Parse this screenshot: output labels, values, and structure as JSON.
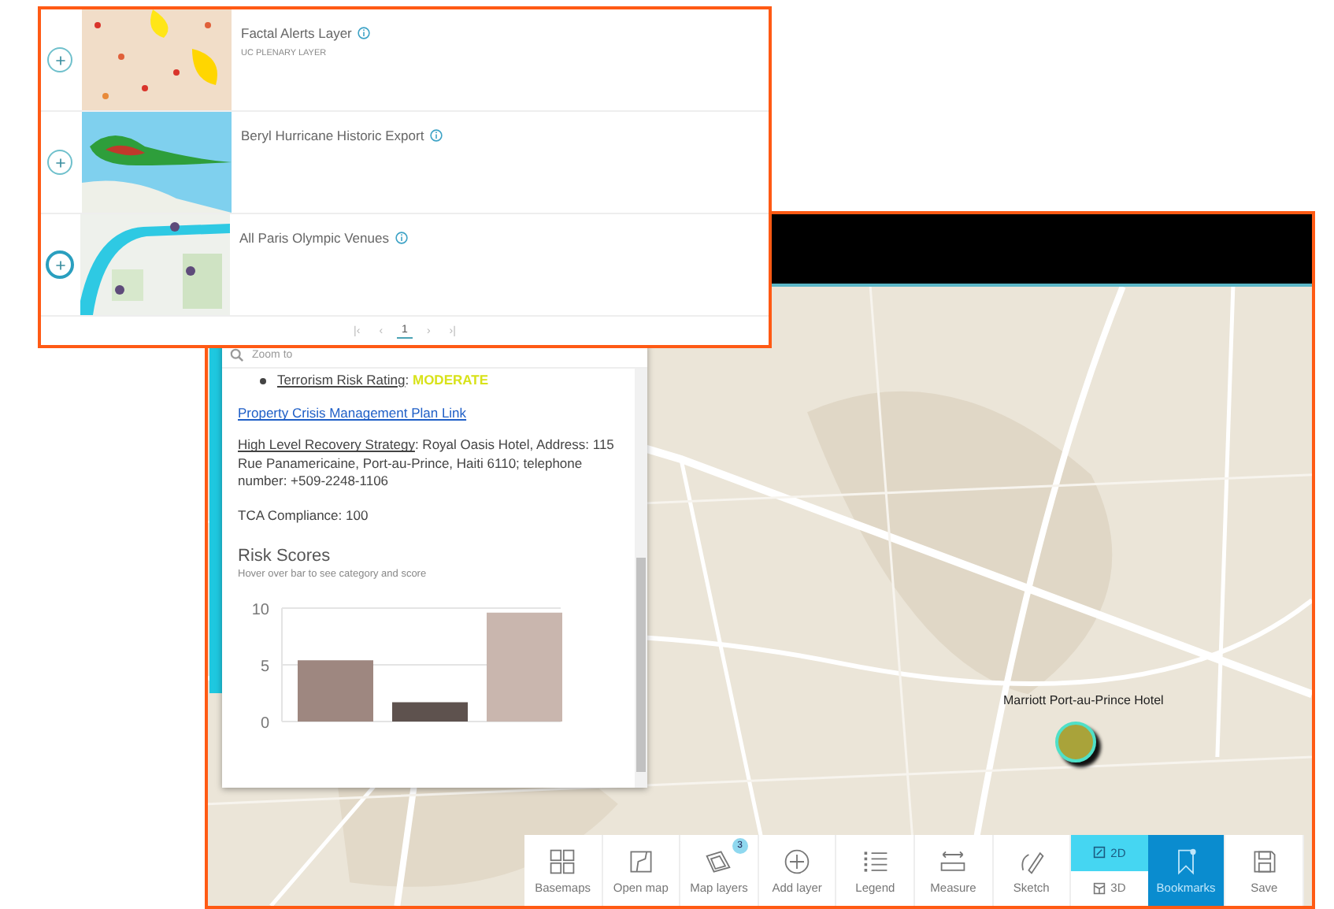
{
  "layer_panel": {
    "items": [
      {
        "title": "Factal Alerts Layer",
        "subtitle": "UC PLENARY LAYER",
        "focused": false
      },
      {
        "title": "Beryl Hurricane Historic Export",
        "focused": false
      },
      {
        "title": "All Paris Olympic Venues",
        "focused": true
      }
    ],
    "pagination": {
      "first": "|‹",
      "prev": "‹",
      "page": "1",
      "next": "›",
      "last": "›|"
    }
  },
  "map": {
    "hotel_label": "Marriott Port-au-Prince Hotel"
  },
  "popup": {
    "zoom_to": "Zoom to",
    "rating": {
      "label": "Terrorism Risk Rating",
      "separator": ":",
      "value": "MODERATE"
    },
    "link": "Property Crisis Management Plan Link",
    "strategy": {
      "label": "High Level Recovery Strategy",
      "text": ": Royal Oasis Hotel, Address: 115 Rue Panamericaine, Port-au-Prince, Haiti 6110; telephone number: +509-2248-1106"
    },
    "compliance": "TCA Compliance: 100",
    "heading": "Risk Scores",
    "hint": "Hover over bar to see category and score",
    "chart_data": {
      "type": "bar",
      "values": [
        5.4,
        1.7,
        9.6
      ],
      "ylim": [
        0,
        10
      ],
      "yticks": [
        0,
        5,
        10
      ]
    }
  },
  "toolbar": {
    "items": [
      {
        "kind": "tool",
        "label": "Basemaps"
      },
      {
        "kind": "tool",
        "label": "Open map"
      },
      {
        "kind": "tool",
        "label": "Map layers",
        "badge": "3"
      },
      {
        "kind": "tool",
        "label": "Add layer"
      },
      {
        "kind": "tool",
        "label": "Legend"
      },
      {
        "kind": "tool",
        "label": "Measure"
      },
      {
        "kind": "tool",
        "label": "Sketch"
      },
      {
        "kind": "toggle",
        "options": [
          {
            "label": "2D",
            "selected": true
          },
          {
            "label": "3D",
            "selected": false
          }
        ]
      },
      {
        "kind": "tool",
        "label": "Bookmarks",
        "selected": true
      },
      {
        "kind": "tool",
        "label": "Save"
      }
    ]
  }
}
